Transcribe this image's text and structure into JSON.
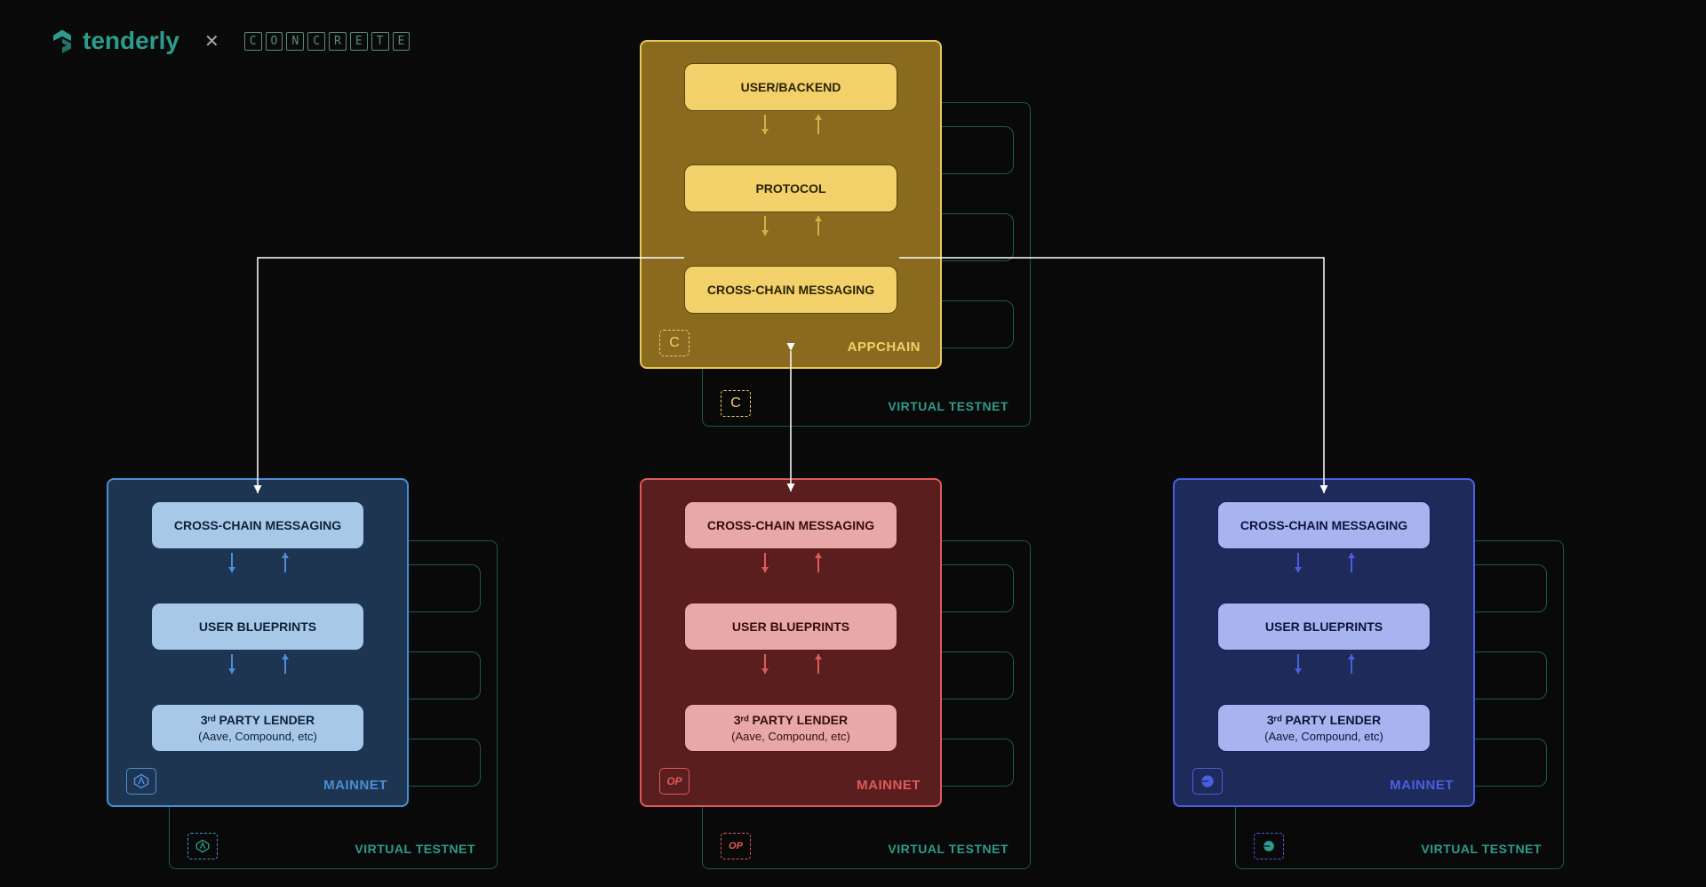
{
  "header": {
    "brand": "tenderly",
    "partner_letters": [
      "C",
      "O",
      "N",
      "C",
      "R",
      "E",
      "T",
      "E"
    ]
  },
  "appchain": {
    "boxes": [
      "USER/BACKEND",
      "PROTOCOL",
      "CROSS-CHAIN MESSAGING"
    ],
    "label": "APPCHAIN",
    "testnet_label": "VIRTUAL TESTNET",
    "chip": "C"
  },
  "chain_template": {
    "box1": "CROSS-CHAIN MESSAGING",
    "box2": "USER BLUEPRINTS",
    "box3_line1": "3ʳᵈ PARTY LENDER",
    "box3_line2": "(Aave, Compound, etc)",
    "label": "MAINNET",
    "testnet_label": "VIRTUAL TESTNET"
  },
  "chains": [
    {
      "variant": "blue",
      "icon": "arbitrum"
    },
    {
      "variant": "red",
      "icon": "optimism"
    },
    {
      "variant": "indigo",
      "icon": "base"
    }
  ]
}
